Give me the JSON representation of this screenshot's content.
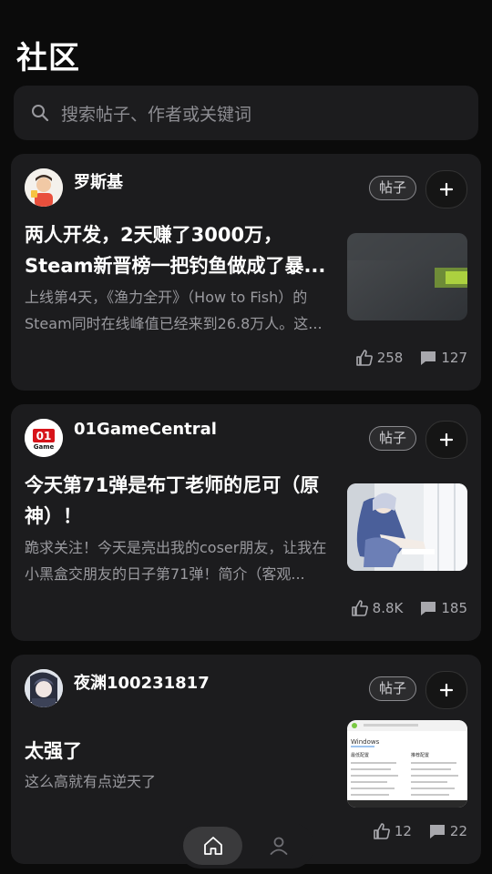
{
  "page": {
    "title": "社区"
  },
  "search": {
    "placeholder": "搜索帖子、作者或关键词",
    "icon": "search-icon"
  },
  "posts": [
    {
      "author": "罗斯基",
      "badge": "帖子",
      "title": "两人开发，2天赚了3000万，Steam新晋榜一把钓鱼做成了暴...",
      "excerpt": "上线第4天，《渔力全开》（How to Fish）的Steam同时在线峰值已经来到26.8万人。这...",
      "likes": "258",
      "comments": "127"
    },
    {
      "author": "01GameCentral",
      "badge": "帖子",
      "title": "今天第71弹是布丁老师的尼可（原神）！",
      "excerpt": "跪求关注！今天是亮出我的coser朋友，让我在小黑盒交朋友的日子第71弹！简介（客观...",
      "likes": "8.8K",
      "comments": "185"
    },
    {
      "author": "夜渊100231817",
      "badge": "帖子",
      "title": "太强了",
      "excerpt": "这么高就有点逆天了",
      "likes": "12",
      "comments": "22"
    }
  ],
  "thumb3": {
    "header": "Windows",
    "left_col": "最低配置",
    "right_col": "推荐配置"
  },
  "colors": {
    "background": "#0b0b0b",
    "card": "#1c1c1e",
    "muted": "#9a9a9f"
  }
}
